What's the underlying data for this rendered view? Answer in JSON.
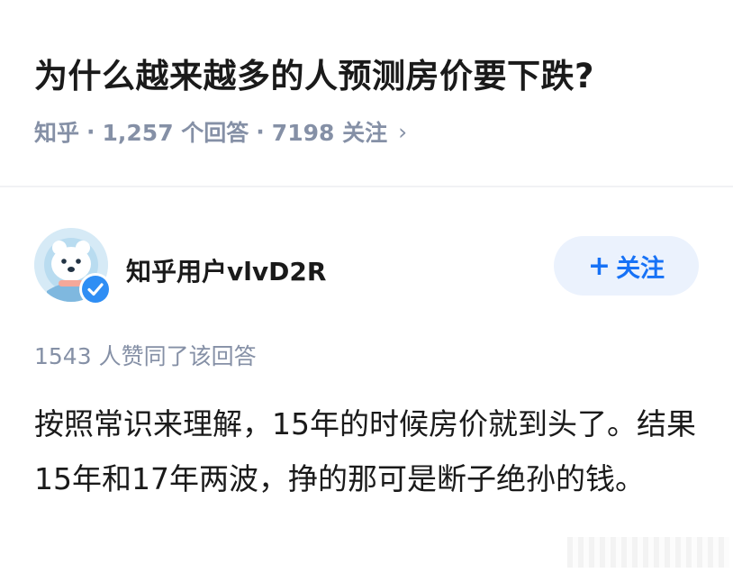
{
  "question": {
    "title": "为什么越来越多的人预测房价要下跌?",
    "source": "知乎",
    "answers": "1,257 个回答",
    "followers": "7198 关注",
    "separator": "·",
    "chevron": "›"
  },
  "answer": {
    "author_name": "知乎用户vlvD2R",
    "avatar_icon": "bear-avatar-icon",
    "verified_icon": "verified-check-icon",
    "follow_plus": "+",
    "follow_label": "关注",
    "votes": "1543 人赞同了该回答",
    "body": "按照常识来理解，15年的时候房价就到头了。结果15年和17年两波，挣的那可是断子绝孙的钱。"
  },
  "colors": {
    "title": "#1a1a1a",
    "meta": "#8590a6",
    "accent": "#1772f6",
    "button_bg": "#ebf2fd",
    "verified": "#2f8ef4"
  }
}
